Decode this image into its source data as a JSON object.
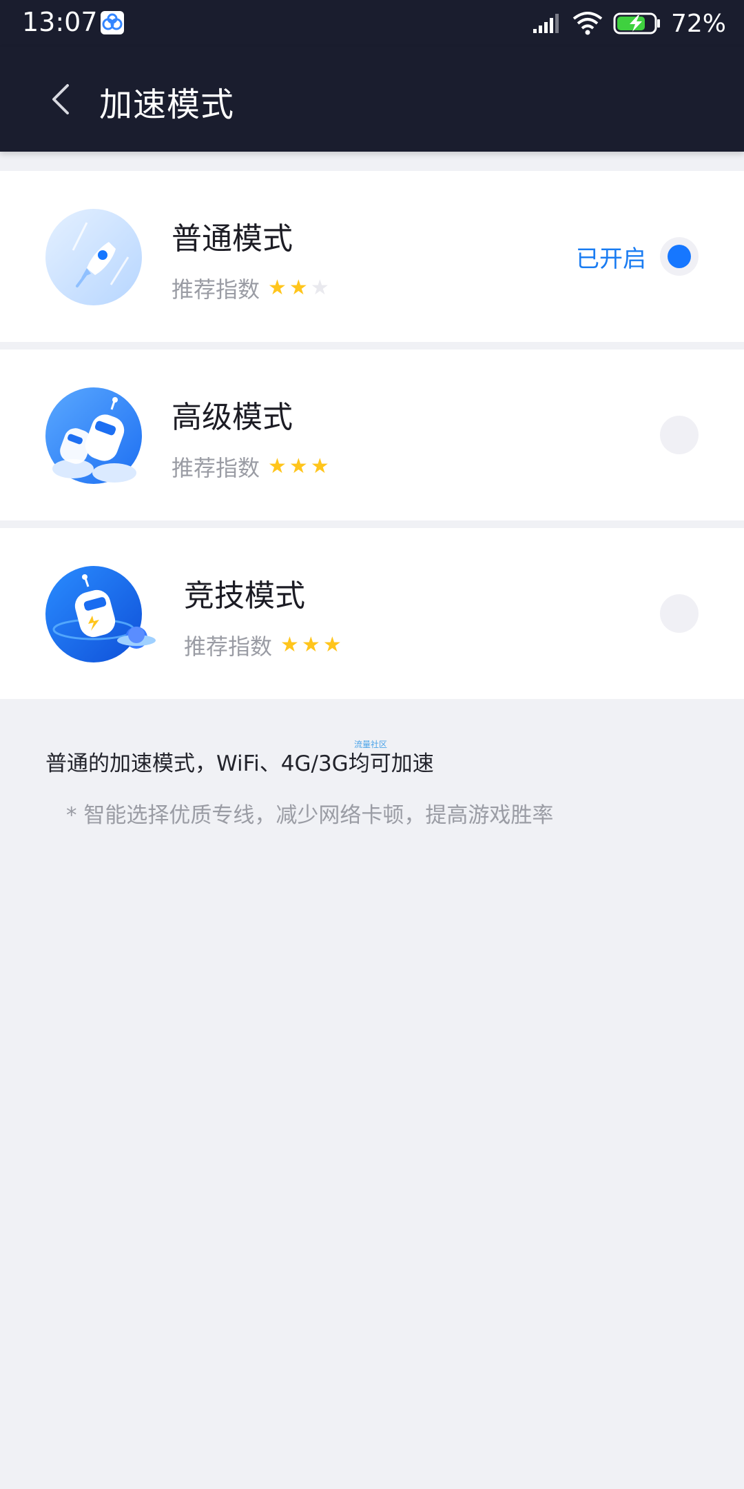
{
  "status_bar": {
    "time": "13:07",
    "battery_percent": "72%",
    "icons": [
      "baidu-cloud-icon",
      "signal-icon",
      "wifi-icon",
      "battery-charging-icon"
    ]
  },
  "header": {
    "title": "加速模式",
    "back_icon": "chevron-left-icon"
  },
  "modes": [
    {
      "title": "普通模式",
      "rating_label": "推荐指数",
      "stars_filled": 2,
      "stars_total": 3,
      "status": "已开启",
      "selected": true,
      "icon": "rocket-icon"
    },
    {
      "title": "高级模式",
      "rating_label": "推荐指数",
      "stars_filled": 3,
      "stars_total": 3,
      "status": "",
      "selected": false,
      "icon": "robot-icon"
    },
    {
      "title": "竞技模式",
      "rating_label": "推荐指数",
      "stars_filled": 3,
      "stars_total": 3,
      "status": "",
      "selected": false,
      "icon": "robot-planet-icon"
    }
  ],
  "description": {
    "main": "普通的加速模式，WiFi、4G/3G均可加速",
    "sub": "* 智能选择优质专线，减少网络卡顿，提高游戏胜率",
    "watermark": "流量社区"
  },
  "colors": {
    "header_bg": "#1a1d2e",
    "accent": "#1677ff",
    "star": "#ffc51c",
    "page_bg": "#f0f1f5"
  }
}
